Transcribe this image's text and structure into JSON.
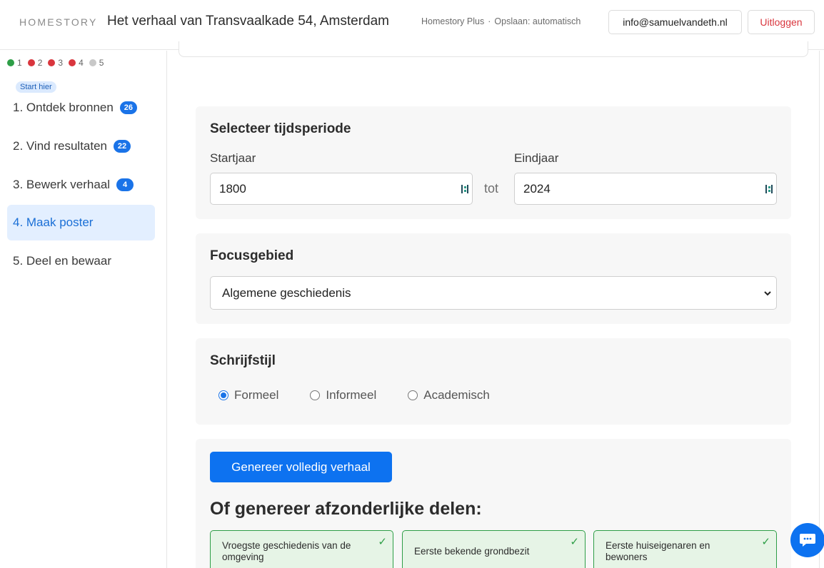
{
  "header": {
    "logo": "HOMESTORY",
    "title": "Het verhaal van Transvaalkade 54, Amsterdam",
    "plan": "Homestory Plus",
    "separator": "·",
    "save_status": "Opslaan: automatisch",
    "email": "info@samuelvandeth.nl",
    "logout": "Uitloggen"
  },
  "progress": [
    {
      "label": "1",
      "color": "#2e9e47"
    },
    {
      "label": "2",
      "color": "#d9363e"
    },
    {
      "label": "3",
      "color": "#d9363e"
    },
    {
      "label": "4",
      "color": "#d9363e"
    },
    {
      "label": "5",
      "color": "#c8c8c8"
    }
  ],
  "sidebar": {
    "start_badge": "Start hier",
    "items": [
      {
        "label": "1. Ontdek bronnen",
        "count": "26"
      },
      {
        "label": "2. Vind resultaten",
        "count": "22"
      },
      {
        "label": "3. Bewerk verhaal",
        "count": "4"
      },
      {
        "label": "4. Maak poster",
        "count": null,
        "active": true
      },
      {
        "label": "5. Deel en bewaar",
        "count": null
      }
    ]
  },
  "period": {
    "title": "Selecteer tijdsperiode",
    "start_label": "Startjaar",
    "start_value": "1800",
    "between": "tot",
    "end_label": "Eindjaar",
    "end_value": "2024"
  },
  "focus": {
    "title": "Focusgebied",
    "selected": "Algemene geschiedenis"
  },
  "style": {
    "title": "Schrijfstijl",
    "options": [
      "Formeel",
      "Informeel",
      "Academisch"
    ],
    "selected": "Formeel"
  },
  "generate": {
    "button": "Genereer volledig verhaal",
    "sub_heading": "Of genereer afzonderlijke delen:",
    "parts": [
      {
        "label": "Vroegste geschiedenis van de omgeving",
        "done": true
      },
      {
        "label": "Eerste bekende grondbezit",
        "done": true
      },
      {
        "label": "Eerste huiseigenaren en bewoners",
        "done": true
      }
    ]
  },
  "colors": {
    "accent": "#0d72f0",
    "done": "#2e9e47",
    "danger": "#d9363e"
  }
}
